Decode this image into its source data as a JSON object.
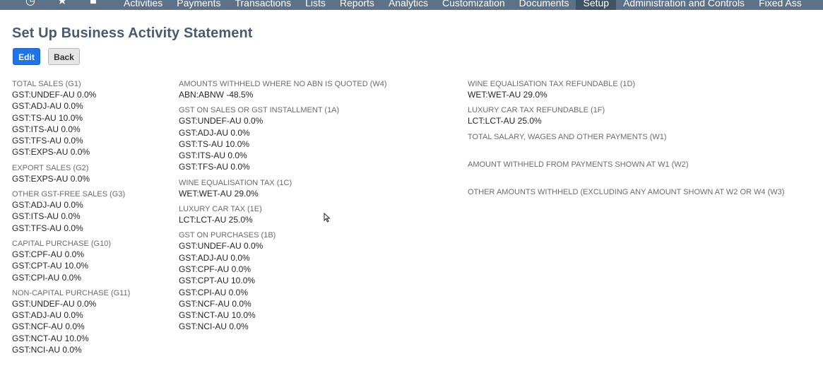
{
  "topnav": {
    "icons": [
      "clock-icon",
      "star-icon",
      "home-icon"
    ],
    "items": [
      "Activities",
      "Payments",
      "Transactions",
      "Lists",
      "Reports",
      "Analytics",
      "Customization",
      "Documents",
      "Setup",
      "Administration and Controls",
      "Fixed Ass"
    ],
    "active": "Setup"
  },
  "page": {
    "title": "Set Up Business Activity Statement",
    "edit_label": "Edit",
    "back_label": "Back"
  },
  "columns": [
    {
      "sections": [
        {
          "label": "TOTAL SALES (G1)",
          "values": [
            "GST:UNDEF-AU 0.0%",
            "GST:ADJ-AU 0.0%",
            "GST:TS-AU 10.0%",
            "GST:ITS-AU 0.0%",
            "GST:TFS-AU 0.0%",
            "GST:EXPS-AU 0.0%"
          ]
        },
        {
          "label": "EXPORT SALES (G2)",
          "values": [
            "GST:EXPS-AU 0.0%"
          ]
        },
        {
          "label": "OTHER GST-FREE SALES (G3)",
          "values": [
            "GST:ADJ-AU 0.0%",
            "GST:ITS-AU 0.0%",
            "GST:TFS-AU 0.0%"
          ]
        },
        {
          "label": "CAPITAL PURCHASE (G10)",
          "values": [
            "GST:CPF-AU 0.0%",
            "GST:CPT-AU 10.0%",
            "GST:CPI-AU 0.0%"
          ]
        },
        {
          "label": "NON-CAPITAL PURCHASE (G11)",
          "values": [
            "GST:UNDEF-AU 0.0%",
            "GST:ADJ-AU 0.0%",
            "GST:NCF-AU 0.0%",
            "GST:NCT-AU 10.0%",
            "GST:NCI-AU 0.0%"
          ]
        }
      ]
    },
    {
      "sections": [
        {
          "label": "AMOUNTS WITHHELD WHERE NO ABN IS QUOTED (W4)",
          "values": [
            "ABN:ABNW -48.5%"
          ]
        },
        {
          "label": "GST ON SALES OR GST INSTALLMENT (1A)",
          "values": [
            "GST:UNDEF-AU 0.0%",
            "GST:ADJ-AU 0.0%",
            "GST:TS-AU 10.0%",
            "GST:ITS-AU 0.0%",
            "GST:TFS-AU 0.0%"
          ]
        },
        {
          "label": "WINE EQUALISATION TAX (1C)",
          "values": [
            "WET:WET-AU 29.0%"
          ]
        },
        {
          "label": "LUXURY CAR TAX (1E)",
          "values": [
            "LCT:LCT-AU 25.0%"
          ]
        },
        {
          "label": "GST ON PURCHASES (1B)",
          "values": [
            "GST:UNDEF-AU 0.0%",
            "GST:ADJ-AU 0.0%",
            "GST:CPF-AU 0.0%",
            "GST:CPT-AU 10.0%",
            "GST:CPI-AU 0.0%",
            "GST:NCF-AU 0.0%",
            "GST:NCT-AU 10.0%",
            "GST:NCI-AU 0.0%"
          ]
        }
      ]
    },
    {
      "sections": [
        {
          "label": "WINE EQUALISATION TAX REFUNDABLE (1D)",
          "values": [
            "WET:WET-AU 29.0%"
          ]
        },
        {
          "label": "LUXURY CAR TAX REFUNDABLE (1F)",
          "values": [
            "LCT:LCT-AU 25.0%"
          ]
        },
        {
          "label": "TOTAL SALARY, WAGES AND OTHER PAYMENTS (W1)",
          "values": []
        },
        {
          "label": "AMOUNT WITHHELD FROM PAYMENTS SHOWN AT W1 (W2)",
          "values": []
        },
        {
          "label": "OTHER AMOUNTS WITHHELD (EXCLUDING ANY AMOUNT SHOWN AT W2 OR W4 (W3)",
          "values": []
        }
      ]
    }
  ]
}
